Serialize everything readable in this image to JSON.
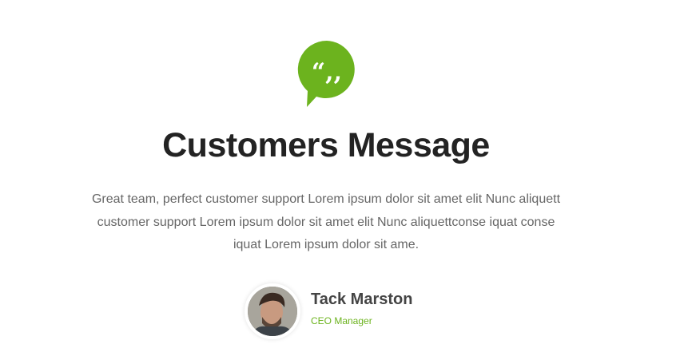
{
  "section": {
    "icon": "quote-bubble-icon",
    "title": "Customers Message",
    "message_lines": [
      "Great team, perfect customer support Lorem ipsum dolor sit amet elit Nunc aliquett",
      "customer support Lorem ipsum dolor sit amet elit Nunc aliquettconse iquat conse",
      "iquat Lorem ipsum dolor sit ame."
    ]
  },
  "author": {
    "name": "Tack Marston",
    "role": "CEO Manager"
  },
  "colors": {
    "accent": "#6cb31e",
    "title": "#232323",
    "text": "#666666"
  }
}
